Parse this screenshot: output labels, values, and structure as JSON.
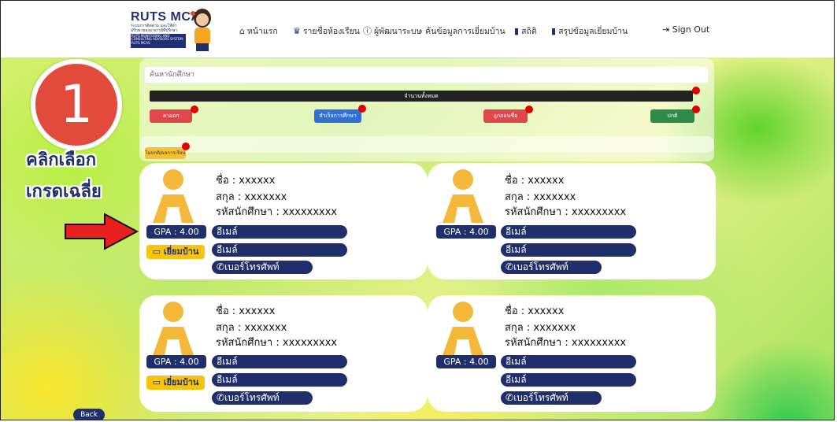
{
  "logo": {
    "title_a": "RUTS",
    "title_b": "MCAS",
    "sub": "ระบบการติดตาม และให้คำปรึกษาของอาจารย์ที่ปรึกษา",
    "band": "RUTS MONITORING AND CONSULTING ADVISORS SYSTEM: RUTS MCAS"
  },
  "nav": [
    {
      "icon": "home-icon",
      "glyph": "⌂",
      "label": "หน้าแรก"
    },
    {
      "icon": "graduation-cap-icon",
      "glyph": "🎓",
      "label": "รายชื่อห้องเรียน"
    },
    {
      "icon": "info-icon",
      "glyph": "ⓘ",
      "label": "ผู้พัฒนาระบบ"
    },
    {
      "icon": "search-icon",
      "glyph": "🔍",
      "label": "ค้นข้อมูลการเยี่ยมบ้าน"
    },
    {
      "icon": "bar-chart-icon",
      "glyph": "▮",
      "label": "สถิติ"
    },
    {
      "icon": "bar-chart-icon",
      "glyph": "▮",
      "label": "สรุปข้อมูลเยี่ยมบ้าน"
    }
  ],
  "signout": "Sign Out",
  "search": {
    "placeholder": "ค้นหานักศึกษา"
  },
  "total_label": "จำนวนทั้งหมด",
  "filters": [
    {
      "label": "ลาออก",
      "color": "#e0474c"
    },
    {
      "label": "สำเร็จการศึกษา",
      "color": "#2f6fd6"
    },
    {
      "label": "ถูกถอนชื่อ",
      "color": "#e0474c"
    },
    {
      "label": "ปกติ",
      "color": "#2e8b47"
    }
  ],
  "grade_filter": "ไม่ปกติ/ผลการเรียน",
  "annotation": {
    "step_number": "1",
    "line1": "คลิกเลือก",
    "line2": "เกรดเฉลี่ย"
  },
  "cards": [
    {
      "name": "ชื่อ : xxxxxx",
      "surname": "สกุล : xxxxxxx",
      "student_id": "รหัสนักศึกษา : xxxxxxxxx",
      "gpa": "GPA : 4.00",
      "email1": "อีเมล์",
      "email2": "อีเมล์",
      "phone": "เบอร์โทรศัพท์",
      "visit": "เยี่ยมบ้าน"
    },
    {
      "name": "ชื่อ : xxxxxx",
      "surname": "สกุล : xxxxxxx",
      "student_id": "รหัสนักศึกษา : xxxxxxxxx",
      "gpa": "GPA : 4.00",
      "email1": "อีเมล์",
      "email2": "อีเมล์",
      "phone": "เบอร์โทรศัพท์",
      "visit": ""
    },
    {
      "name": "ชื่อ : xxxxxx",
      "surname": "สกุล : xxxxxxx",
      "student_id": "รหัสนักศึกษา : xxxxxxxxx",
      "gpa": "GPA : 4.00",
      "email1": "อีเมล์",
      "email2": "อีเมล์",
      "phone": "เบอร์โทรศัพท์",
      "visit": "เยี่ยมบ้าน"
    },
    {
      "name": "ชื่อ : xxxxxx",
      "surname": "สกุล : xxxxxxx",
      "student_id": "รหัสนักศึกษา : xxxxxxxxx",
      "gpa": "GPA : 4.00",
      "email1": "อีเมล์",
      "email2": "อีเมล์",
      "phone": "เบอร์โทรศัพท์",
      "visit": ""
    }
  ],
  "back": "Back",
  "colors": {
    "navy": "#1f2f6b",
    "accent_red": "#e24b3b",
    "visit_yellow": "#f8c30a"
  }
}
